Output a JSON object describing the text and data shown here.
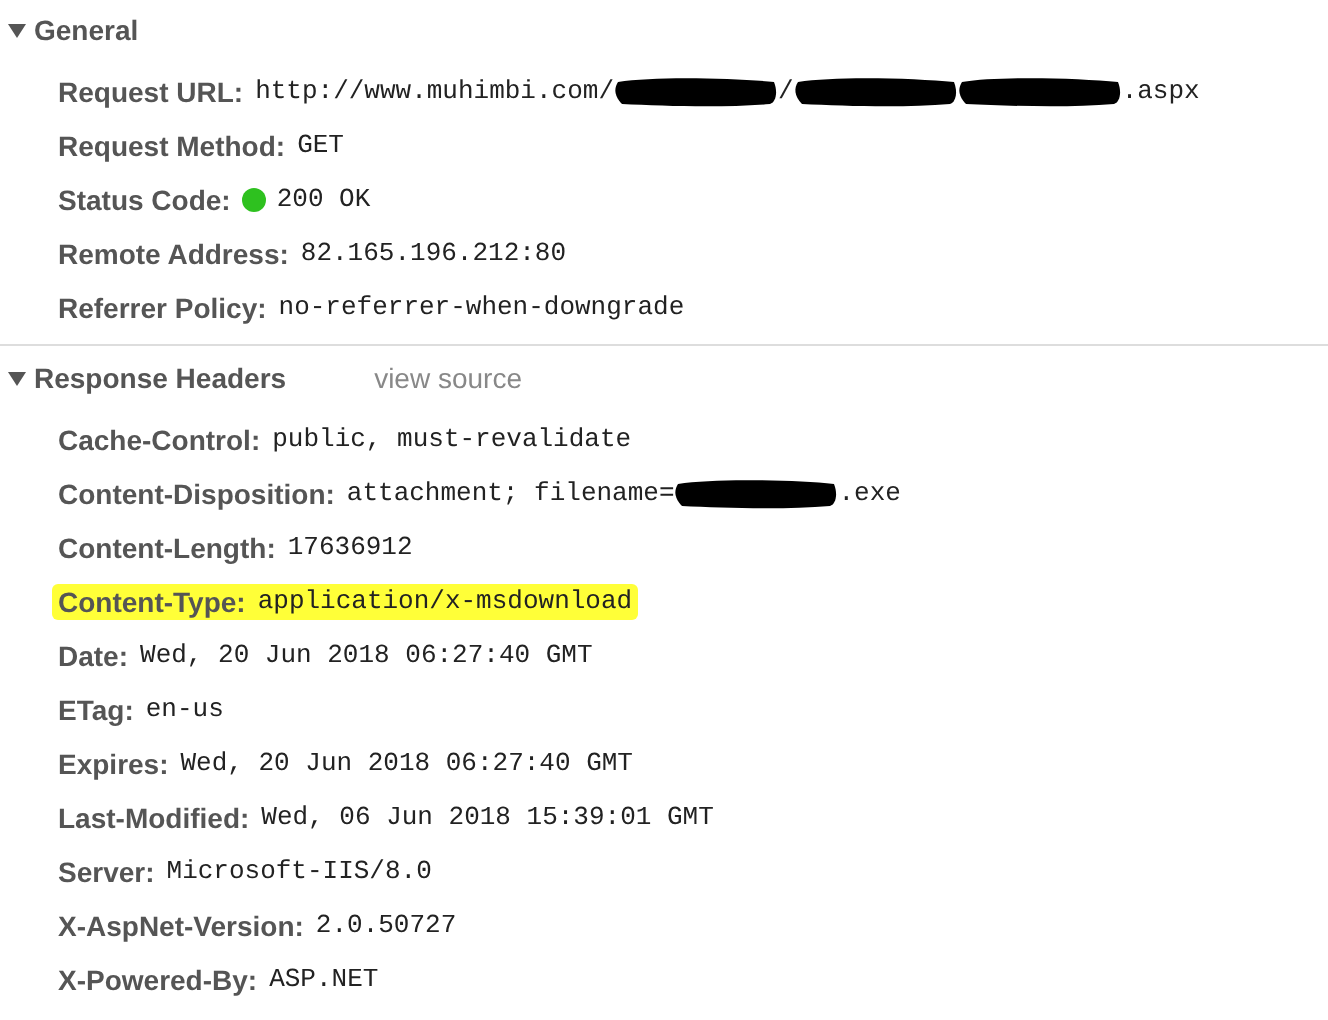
{
  "sections": [
    {
      "title": "General",
      "expanded": true,
      "headers": [
        {
          "name": "Request URL:",
          "highlighted": false,
          "value": [
            {
              "kind": "text",
              "text": "http://www.muhimbi.com/"
            },
            {
              "kind": "redacted"
            },
            {
              "kind": "text",
              "text": "/"
            },
            {
              "kind": "redacted"
            },
            {
              "kind": "redacted"
            },
            {
              "kind": "text",
              "text": ".aspx"
            }
          ]
        },
        {
          "name": "Request Method:",
          "highlighted": false,
          "value": [
            {
              "kind": "text",
              "text": "GET"
            }
          ]
        },
        {
          "name": "Status Code:",
          "highlighted": false,
          "color": "#2ec11f",
          "value": [
            {
              "kind": "text",
              "text": "200 OK"
            }
          ]
        },
        {
          "name": "Remote Address:",
          "highlighted": false,
          "value": [
            {
              "kind": "text",
              "text": "82.165.196.212:80"
            }
          ]
        },
        {
          "name": "Referrer Policy:",
          "highlighted": false,
          "value": [
            {
              "kind": "text",
              "text": "no-referrer-when-downgrade"
            }
          ]
        }
      ]
    },
    {
      "title": "Response Headers",
      "expanded": true,
      "link": "view source",
      "headers": [
        {
          "name": "Cache-Control:",
          "highlighted": false,
          "value": [
            {
              "kind": "text",
              "text": "public, must-revalidate"
            }
          ]
        },
        {
          "name": "Content-Disposition:",
          "highlighted": false,
          "value": [
            {
              "kind": "text",
              "text": "attachment; filename="
            },
            {
              "kind": "redacted"
            },
            {
              "kind": "text",
              "text": ".exe"
            }
          ]
        },
        {
          "name": "Content-Length:",
          "highlighted": false,
          "value": [
            {
              "kind": "text",
              "text": "17636912"
            }
          ]
        },
        {
          "name": "Content-Type:",
          "highlighted": true,
          "value": [
            {
              "kind": "text",
              "text": "application/x-msdownload"
            }
          ]
        },
        {
          "name": "Date:",
          "highlighted": false,
          "value": [
            {
              "kind": "text",
              "text": "Wed, 20 Jun 2018 06:27:40 GMT"
            }
          ]
        },
        {
          "name": "ETag:",
          "highlighted": false,
          "value": [
            {
              "kind": "text",
              "text": "en-us"
            }
          ]
        },
        {
          "name": "Expires:",
          "highlighted": false,
          "value": [
            {
              "kind": "text",
              "text": "Wed, 20 Jun 2018 06:27:40 GMT"
            }
          ]
        },
        {
          "name": "Last-Modified:",
          "highlighted": false,
          "value": [
            {
              "kind": "text",
              "text": "Wed, 06 Jun 2018 15:39:01 GMT"
            }
          ]
        },
        {
          "name": "Server:",
          "highlighted": false,
          "value": [
            {
              "kind": "text",
              "text": "Microsoft-IIS/8.0"
            }
          ]
        },
        {
          "name": "X-AspNet-Version:",
          "highlighted": false,
          "value": [
            {
              "kind": "text",
              "text": "2.0.50727"
            }
          ]
        },
        {
          "name": "X-Powered-By:",
          "highlighted": false,
          "value": [
            {
              "kind": "text",
              "text": "ASP.NET"
            }
          ]
        }
      ]
    }
  ]
}
